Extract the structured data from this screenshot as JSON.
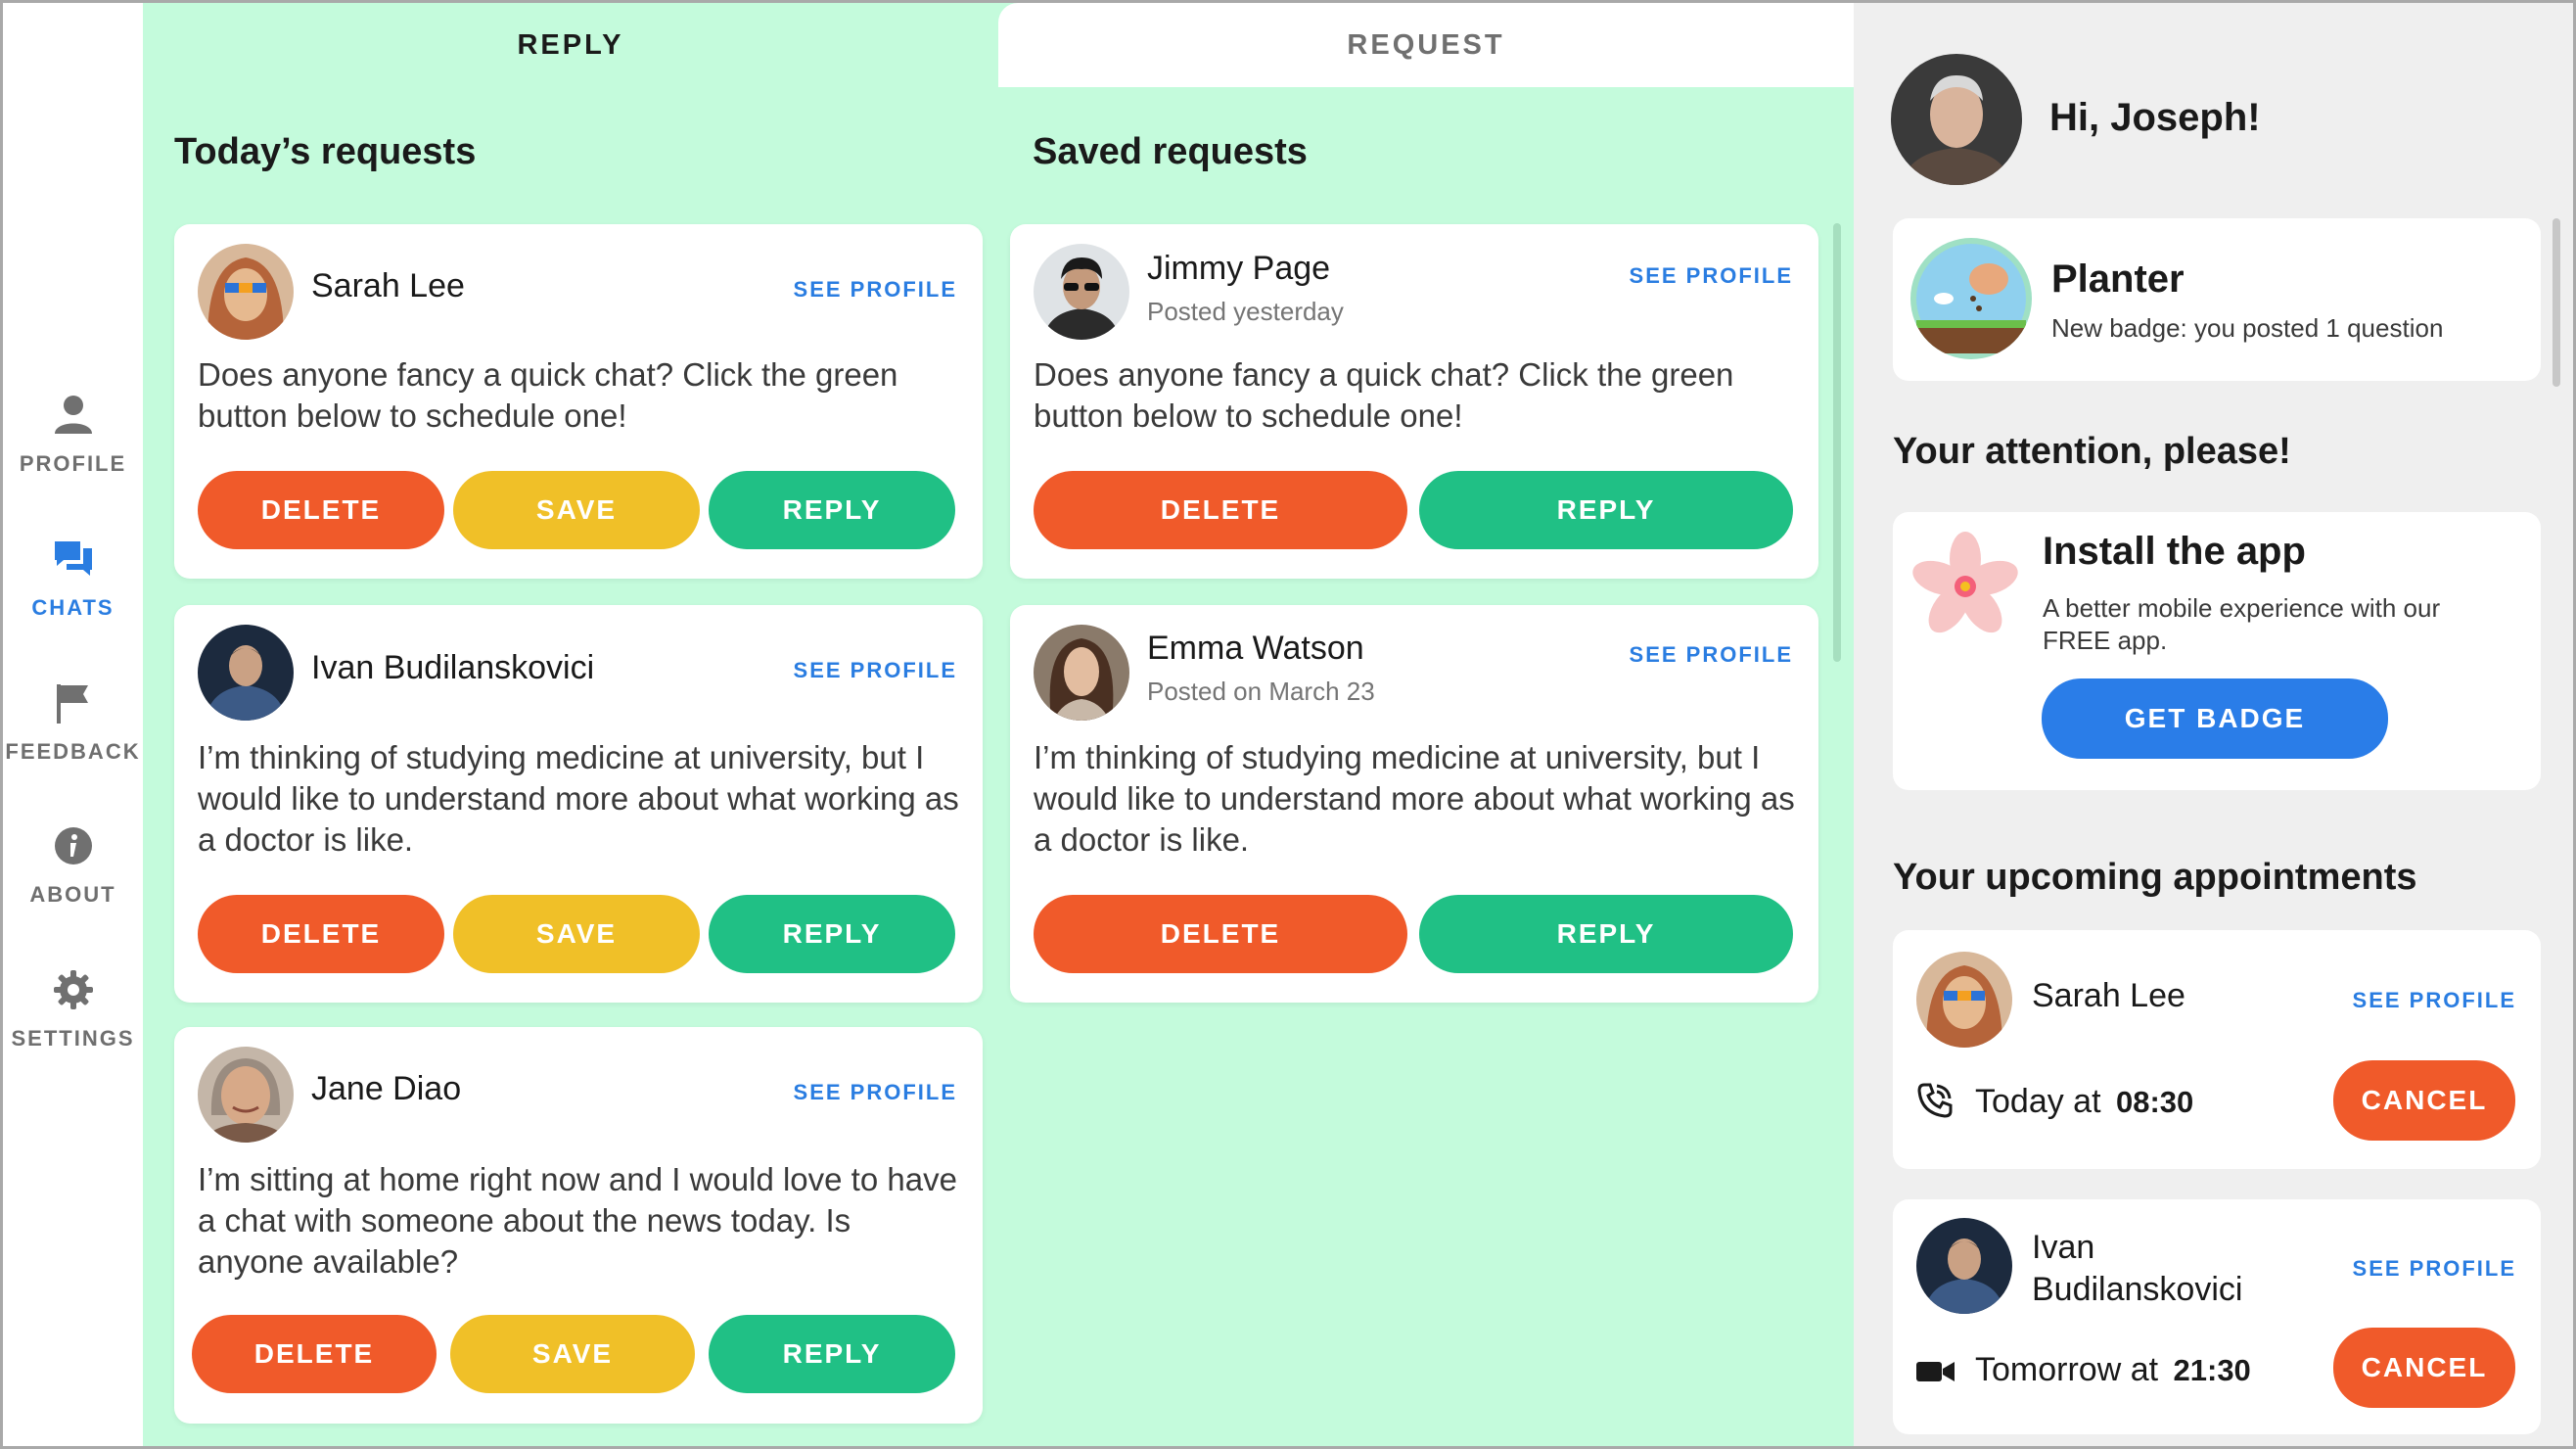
{
  "nav": {
    "items": [
      {
        "label": "PROFILE",
        "icon": "person-icon",
        "active": false
      },
      {
        "label": "CHATS",
        "icon": "chat-bubbles-icon",
        "active": true
      },
      {
        "label": "FEEDBACK",
        "icon": "flag-icon",
        "active": false
      },
      {
        "label": "ABOUT",
        "icon": "info-icon",
        "active": false
      },
      {
        "label": "SETTINGS",
        "icon": "gear-icon",
        "active": false
      }
    ]
  },
  "tabs": {
    "reply": "REPLY",
    "request": "REQUEST",
    "active": "REPLY"
  },
  "todays": {
    "title": "Today’s requests",
    "cards": [
      {
        "name": "Sarah Lee",
        "see_profile": "SEE PROFILE",
        "message": "Does anyone fancy a quick chat? Click the green button below to schedule one!",
        "delete": "DELETE",
        "save": "SAVE",
        "reply": "REPLY"
      },
      {
        "name": "Ivan Budilanskovici",
        "see_profile": "SEE PROFILE",
        "message": "I’m thinking of studying medicine at university, but I would like to understand more about what working as a doctor is like.",
        "delete": "DELETE",
        "save": "SAVE",
        "reply": "REPLY"
      },
      {
        "name": "Jane Diao",
        "see_profile": "SEE PROFILE",
        "message": "I’m sitting at home right now and I would love to have a chat with someone about the news today. Is anyone available?",
        "delete": "DELETE",
        "save": "SAVE",
        "reply": "REPLY"
      }
    ]
  },
  "saved": {
    "title": "Saved requests",
    "cards": [
      {
        "name": "Jimmy Page",
        "posted": "Posted yesterday",
        "see_profile": "SEE PROFILE",
        "message": "Does anyone fancy a quick chat? Click the green button below to schedule one!",
        "delete": "DELETE",
        "reply": "REPLY"
      },
      {
        "name": "Emma Watson",
        "posted": "Posted on March 23",
        "see_profile": "SEE PROFILE",
        "message": "I’m thinking of studying medicine at university, but I would like to understand more about what working as a doctor is like.",
        "delete": "DELETE",
        "reply": "REPLY"
      }
    ]
  },
  "sidebar": {
    "greeting": "Hi, Joseph!",
    "badge": {
      "title": "Planter",
      "subtitle": "New badge: you posted 1 question"
    },
    "attention_title": "Your attention, please!",
    "install": {
      "title": "Install the app",
      "text": "A better mobile experience with our FREE app.",
      "button": "GET BADGE"
    },
    "appointments_title": "Your upcoming appointments",
    "appointments": [
      {
        "name": "Sarah Lee",
        "see_profile": "SEE PROFILE",
        "type_icon": "phone-icon",
        "when": "Today at",
        "time": "08:30",
        "cancel": "CANCEL"
      },
      {
        "name_line1": "Ivan",
        "name_line2": "Budilanskovici",
        "see_profile": "SEE PROFILE",
        "type_icon": "video-camera-icon",
        "when": "Tomorrow at",
        "time": "21:30",
        "cancel": "CANCEL"
      }
    ]
  },
  "colors": {
    "accent_blue": "#2a7de1",
    "delete_red": "#f05a2a",
    "save_yellow": "#f0c028",
    "reply_green": "#20c085",
    "main_bg": "#c4fbdc",
    "sidebar_bg": "#efefef"
  }
}
